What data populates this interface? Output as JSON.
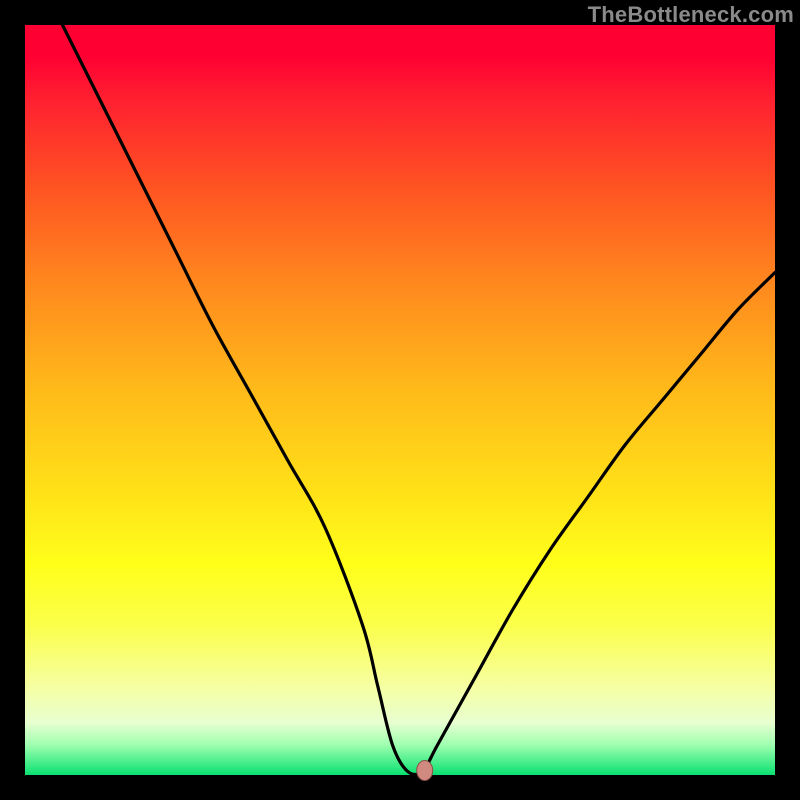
{
  "watermark": "TheBottleneck.com",
  "chart_data": {
    "type": "line",
    "title": "",
    "xlabel": "",
    "ylabel": "",
    "xlim": [
      0,
      100
    ],
    "ylim": [
      0,
      100
    ],
    "grid": false,
    "legend": false,
    "background": "red-yellow-green vertical gradient",
    "series": [
      {
        "name": "curve",
        "x": [
          5,
          10,
          15,
          20,
          25,
          30,
          35,
          40,
          45,
          47,
          49,
          51,
          53,
          55,
          60,
          65,
          70,
          75,
          80,
          85,
          90,
          95,
          100
        ],
        "y": [
          100,
          90,
          80,
          70,
          60,
          51,
          42,
          33,
          20,
          12,
          4,
          0.5,
          0.5,
          4,
          13,
          22,
          30,
          37,
          44,
          50,
          56,
          62,
          67
        ]
      }
    ],
    "marker": {
      "x": 53.3,
      "y": 0.6,
      "color": "#d18a80"
    }
  }
}
